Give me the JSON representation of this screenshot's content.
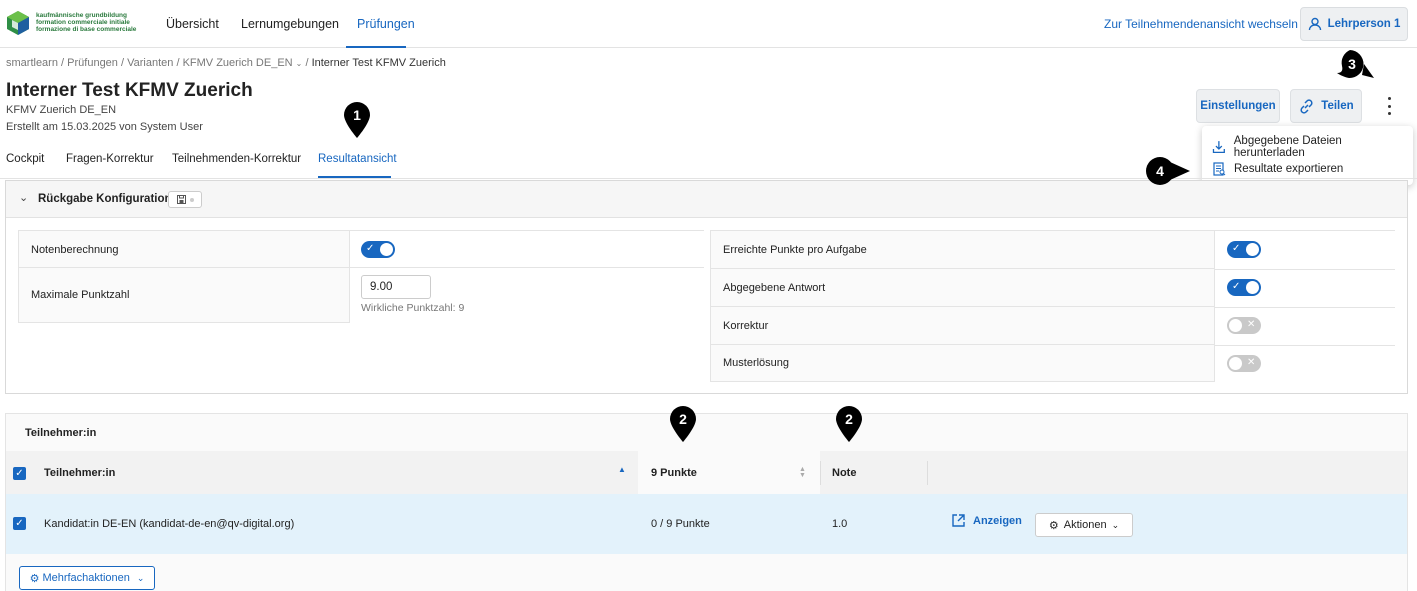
{
  "brand": {
    "logo_lines": [
      "kaufmännische grundbildung",
      "formation commerciale initiale",
      "formazione di base commerciale"
    ]
  },
  "nav": {
    "items": [
      "Übersicht",
      "Lernumgebungen",
      "Prüfungen"
    ],
    "switch_link": "Zur Teilnehmendenansicht wechseln",
    "user": "Lehrperson 1"
  },
  "breadcrumb": {
    "items": [
      "smartlearn",
      "Prüfungen",
      "Varianten",
      "KFMV Zuerich DE_EN"
    ],
    "current": "Interner Test KFMV Zuerich"
  },
  "header": {
    "title": "Interner Test KFMV Zuerich",
    "subtitle": "KFMV Zuerich DE_EN",
    "created": "Erstellt am 15.03.2025 von System User",
    "settings_button": "Einstellungen",
    "share_button": "Teilen"
  },
  "menu": {
    "items": [
      "Abgegebene Dateien herunterladen",
      "Resultate exportieren"
    ]
  },
  "tabs": [
    "Cockpit",
    "Fragen-Korrektur",
    "Teilnehmenden-Korrektur",
    "Resultatansicht"
  ],
  "config": {
    "title": "Rückgabe Konfiguration",
    "grade_label": "Notenberechnung",
    "grade_on": true,
    "max_points_label": "Maximale Punktzahl",
    "max_points_value": "9.00",
    "max_points_hint": "Wirkliche Punktzahl: 9",
    "right": [
      {
        "label": "Erreichte Punkte pro Aufgabe",
        "on": true
      },
      {
        "label": "Abgegebene Antwort",
        "on": true
      },
      {
        "label": "Korrektur",
        "on": false
      },
      {
        "label": "Musterlösung",
        "on": false
      }
    ]
  },
  "participants": {
    "section_title": "Teilnehmer:in",
    "columns": [
      "Teilnehmer:in",
      "9 Punkte",
      "Note"
    ],
    "rows": [
      {
        "name": "Kandidat:in DE-EN (kandidat-de-en@qv-digital.org)",
        "points": "0 / 9 Punkte",
        "grade": "1.0",
        "view": "Anzeigen",
        "actions": "Aktionen"
      }
    ],
    "bulk_button": "Mehrfachaktionen"
  },
  "markers": [
    "1",
    "2",
    "2",
    "3",
    "4"
  ]
}
